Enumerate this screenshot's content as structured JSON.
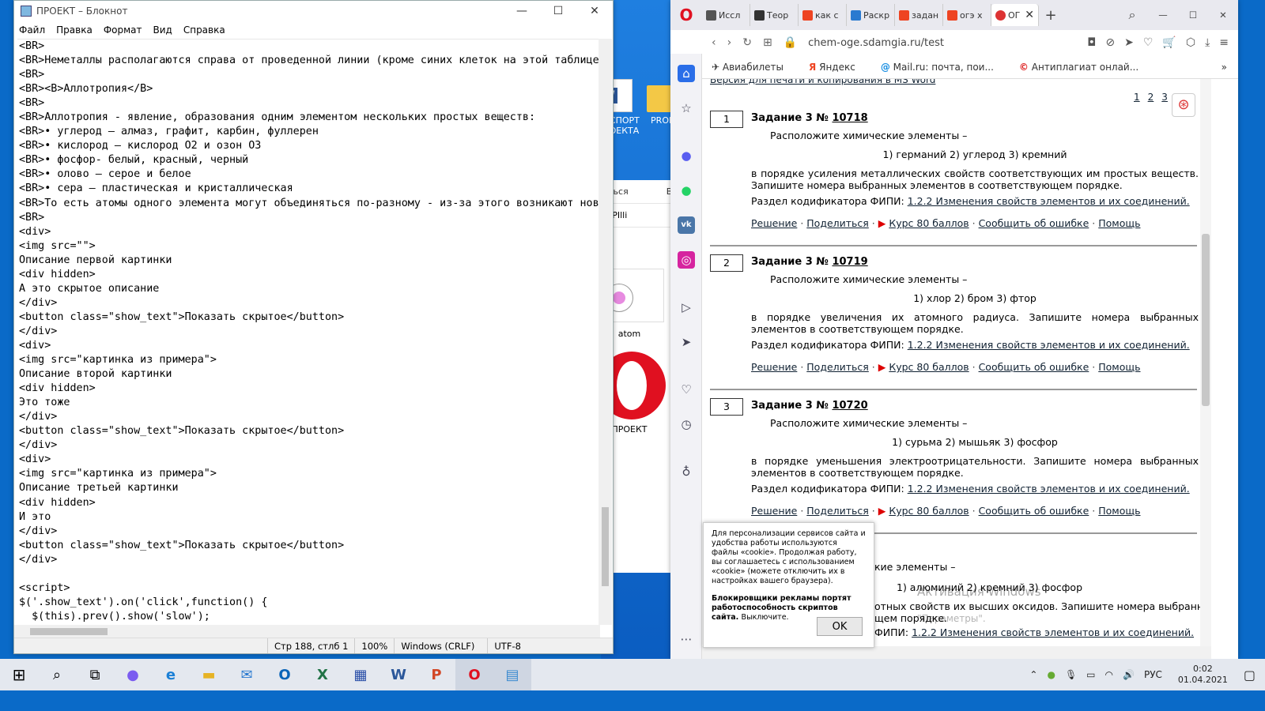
{
  "desktop": {
    "icons": [
      {
        "name": "ПАСПОРТ ПРОЕКТА",
        "icon": "word-doc-icon"
      },
      {
        "name": "PROE",
        "icon": "folder-icon"
      },
      {
        "name": "atom",
        "icon": "image-file-icon"
      },
      {
        "name": "ПРОЕКТ",
        "icon": "opera-logo-icon"
      }
    ],
    "explorer": {
      "col1": "иться",
      "col2": "Вид",
      "row1": "T_PIlli"
    }
  },
  "notepad": {
    "title": "ПРОЕКТ – Блокнот",
    "menu": [
      "Файл",
      "Правка",
      "Формат",
      "Вид",
      "Справка"
    ],
    "lines": [
      "<BR>",
      "<BR>Неметаллы располагаются справа от проведенной линии (кроме синих клеток на этой таблице",
      "<BR>",
      "<BR><B>Аллотропия</B>",
      "<BR>",
      "<BR>Аллотропия - явление, образования одним элементом нескольких простых веществ:",
      "<BR>• углерод – алмаз, графит, карбин, фуллерен",
      "<BR>• кислород – кислород О2 и озон О3",
      "<BR>• фосфор- белый, красный, черный",
      "<BR>• олово – серое и белое",
      "<BR>• сера – пластическая и кристаллическая",
      "<BR>То есть атомы одного элемента могут объединяться по-разному - из-за этого возникают новы",
      "<BR>",
      "<div>",
      "<img src=\"\">",
      "Описание первой картинки",
      "<div hidden>",
      "А это скрытое описание",
      "</div>",
      "<button class=\"show_text\">Показать скрытое</button>",
      "</div>",
      "<div>",
      "<img src=\"картинка из примера\">",
      "Описание второй картинки",
      "<div hidden>",
      "Это тоже",
      "</div>",
      "<button class=\"show_text\">Показать скрытое</button>",
      "</div>",
      "<div>",
      "<img src=\"картинка из примера\">",
      "Описание третьей картинки",
      "<div hidden>",
      "И это",
      "</div>",
      "<button class=\"show_text\">Показать скрытое</button>",
      "</div>",
      "",
      "<script>",
      "$('.show_text').on('click',function() {",
      "  $(this).prev().show('slow');"
    ],
    "status": {
      "position": "Стр 188, стлб 1",
      "zoom": "100%",
      "eol": "Windows (CRLF)",
      "encoding": "UTF-8"
    }
  },
  "browser": {
    "tabs": [
      {
        "label": "Иссл",
        "color": "#555"
      },
      {
        "label": "Теор",
        "color": "#333"
      },
      {
        "label": "как с",
        "color": "#e42"
      },
      {
        "label": "Раскр",
        "color": "#2a7ad0"
      },
      {
        "label": "задан",
        "color": "#e42"
      },
      {
        "label": "огэ х",
        "color": "#e42"
      },
      {
        "label": "ОГ",
        "color": "#d33"
      }
    ],
    "url": "chem-oge.sdamgia.ru/test",
    "bookmarks": [
      "Авиабилеты",
      "Яндекс",
      "Mail.ru: почта, пои...",
      "Антиплагиат онлай..."
    ],
    "top_link": "Версия для печати и копирования в MS Word",
    "pages": [
      "1",
      "2",
      "3"
    ],
    "tasks": [
      {
        "num": "1",
        "title": "Задание 3 №",
        "id": "10718",
        "prompt": "Расположите химические элементы –",
        "elements": "1) германий  2) углерод  3) кремний",
        "body": "в порядке усиления металлических свойств соответствующих им простых веществ. Запишите номера выбранных элементов в соответствующем порядке.",
        "codifier_label": "Раздел кодификатора ФИПИ:",
        "codifier": "1.2.2 Изменения свойств элементов и их соединений."
      },
      {
        "num": "2",
        "title": "Задание 3 №",
        "id": "10719",
        "prompt": "Расположите химические элементы –",
        "elements": "1) хлор  2) бром  3) фтор",
        "body": "в порядке увеличения их атомного радиуса. Запишите номера выбранных элементов в соответствующем порядке.",
        "codifier_label": "Раздел кодификатора ФИПИ:",
        "codifier": "1.2.2 Изменения свойств элементов и их соединений."
      },
      {
        "num": "3",
        "title": "Задание 3 №",
        "id": "10720",
        "prompt": "Расположите химические элементы –",
        "elements": "1) сурьма  2) мышьяк  3) фосфор",
        "body": "в порядке уменьшения электроотрицательности. Запишите номера выбранных элементов в соответствующем порядке.",
        "codifier_label": "Раздел кодификатора ФИПИ:",
        "codifier": "1.2.2 Изменения свойств элементов и их соединений."
      }
    ],
    "actions": {
      "solution": "Решение",
      "share": "Поделиться",
      "course": "Курс 80 баллов",
      "report": "Сообщить об ошибке",
      "help": "Помощь"
    },
    "task4": {
      "prompt": "кие элементы –",
      "elements": "1) алюминий  2) кремний  3) фосфор",
      "body1": "отных свойств их высших оксидов. Запишите номера выбранных",
      "body2": "щем порядке.",
      "codifier_label": "ФИПИ:",
      "codifier": "1.2.2 Изменения свойств элементов и их соединений."
    },
    "watermark": "Активация Windows",
    "watermark2": "\"Параметры\".",
    "cookie": {
      "text": "Для персонализации сервисов сайта и удобства работы используются файлы «cookie». Продолжая работу, вы соглашаетесь с использованием «cookie» (можете отключить их в настройках вашего браузера).",
      "warning": "Блокировщики рекламы портят работоспособность скриптов сайта.",
      "warning_tail": "Выключите.",
      "ok": "OK"
    }
  },
  "taskbar": {
    "lang": "РУС",
    "time": "0:02",
    "date": "01.04.2021"
  }
}
